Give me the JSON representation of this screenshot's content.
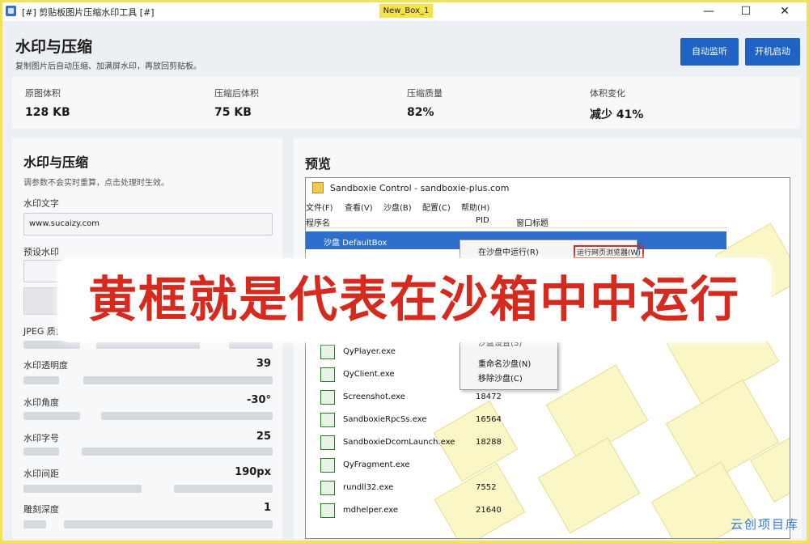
{
  "window": {
    "title": "[#] 剪贴板图片压缩水印工具 [#]",
    "sandbox_tag": "New_Box_1",
    "controls": [
      "—",
      "☐",
      "✕"
    ]
  },
  "header": {
    "title": "水印与压缩",
    "subtitle": "复制图片后自动压缩、加满屏水印，再放回剪贴板。",
    "buttons": {
      "auto_monitor": "自动监听",
      "startup": "开机启动"
    }
  },
  "stats": [
    {
      "label": "原图体积",
      "value": "128 KB"
    },
    {
      "label": "压缩后体积",
      "value": "75 KB"
    },
    {
      "label": "压缩质量",
      "value": "82%"
    },
    {
      "label": "体积变化",
      "value": "减少 41%"
    }
  ],
  "settings": {
    "title": "水印与压缩",
    "hint": "调参数不会实时重算，点击处理时生效。",
    "watermark_text_label": "水印文字",
    "watermark_text_value": "www.sucaizy.com",
    "preset_label": "预设水印",
    "jpeg_label": "JPEG 质量",
    "sliders": [
      {
        "label": "水印透明度",
        "display": "39",
        "value": 39,
        "max": 100
      },
      {
        "label": "水印角度",
        "display": "-30°",
        "value": -30,
        "min": -90,
        "max": 90
      },
      {
        "label": "水印字号",
        "display": "25",
        "value": 25,
        "max": 100
      },
      {
        "label": "水印间距",
        "display": "190px",
        "value": 190,
        "max": 400
      },
      {
        "label": "雕刻深度",
        "display": "1",
        "value": 1,
        "max": 10
      }
    ]
  },
  "preview": {
    "title": "预览",
    "inner_window_title": "Sandboxie Control - sandboxie-plus.com",
    "menu": [
      "文件(F)",
      "查看(V)",
      "沙盘(B)",
      "配置(C)",
      "帮助(H)"
    ],
    "columns": [
      "程序名",
      "PID",
      "窗口标题"
    ],
    "selected_row": "沙盘 DefaultBox",
    "context_menu_top": [
      "在沙盘中运行(R)",
      "运行网页浏览器(W)"
    ],
    "context_menu_bottom": [
      "沙盘设置(S)",
      "重命名沙盘(N)",
      "移除沙盘(C)"
    ],
    "processes": [
      {
        "name": "QyPlayer.exe",
        "pid": ""
      },
      {
        "name": "QyClient.exe",
        "pid": ""
      },
      {
        "name": "Screenshot.exe",
        "pid": "18472"
      },
      {
        "name": "SandboxieRpcSs.exe",
        "pid": "16564"
      },
      {
        "name": "SandboxieDcomLaunch.exe",
        "pid": "18288"
      },
      {
        "name": "QyFragment.exe",
        "pid": ""
      },
      {
        "name": "rundll32.exe",
        "pid": "7552"
      },
      {
        "name": "mdhelper.exe",
        "pid": "21640"
      }
    ]
  },
  "overlay_caption": "黄框就是代表在沙箱中中运行",
  "logo_text": "云创项目库",
  "colors": {
    "accent": "#1f63c6",
    "sandbox_border": "#f2e15a",
    "caption": "#d62a1f"
  }
}
